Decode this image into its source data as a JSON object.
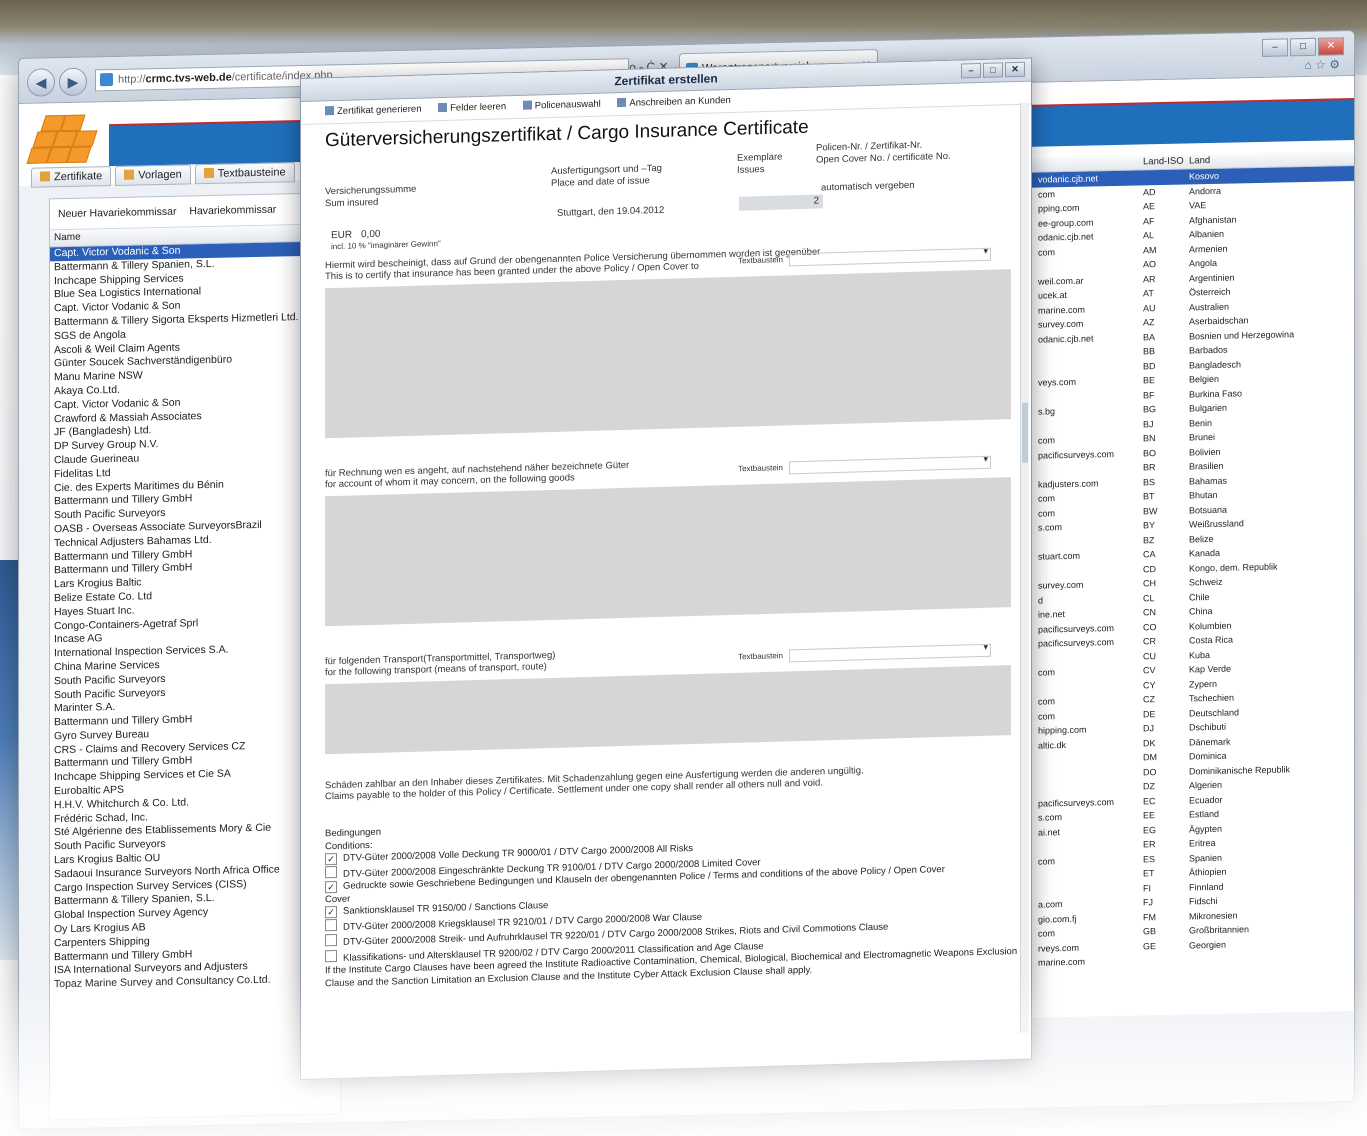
{
  "browser": {
    "url_prefix": "http://",
    "url_domain": "crmc.tvs-web.de",
    "url_path": "/certificate/index.php",
    "address_controls": "ρ - Ċ ✕",
    "tab_title": "Warentransportversicherung",
    "tab_close": "✕"
  },
  "app": {
    "tabs": [
      "Zertifikate",
      "Vorlagen",
      "Textbausteine"
    ],
    "left_toolbar": [
      "Neuer Havariekommissar",
      "Havariekommissar"
    ],
    "left_column_header": "Name",
    "surveyors": [
      "Capt. Victor Vodanic & Son",
      "Battermann & Tillery Spanien, S.L.",
      "Inchcape Shipping Services",
      "Blue Sea Logistics International",
      "Capt. Victor Vodanic & Son",
      "Battermann & Tillery Sigorta Eksperts Hizmetleri Ltd. Sti.",
      "SGS de Angola",
      "Ascoli & Weil Claim Agents",
      "Günter Soucek Sachverständigenbüro",
      "Manu Marine NSW",
      "Akaya Co.Ltd.",
      "Capt. Victor Vodanic & Son",
      "Crawford & Massiah Associates",
      "JF (Bangladesh) Ltd.",
      "DP Survey Group N.V.",
      "Claude Guerineau",
      "Fidelitas Ltd",
      "Cie. des Experts Maritimes du Bénin",
      "Battermann und Tillery GmbH",
      "South Pacific Surveyors",
      "OASB - Overseas Associate SurveyorsBrazil",
      "Technical Adjusters Bahamas Ltd.",
      "Battermann und Tillery GmbH",
      "Battermann und Tillery GmbH",
      "Lars Krogius Baltic",
      "Belize Estate Co. Ltd",
      "Hayes Stuart Inc.",
      "Congo-Containers-Agetraf Sprl",
      "Incase AG",
      "International Inspection Services S.A.",
      "China Marine Services",
      "South Pacific Surveyors",
      "South Pacific Surveyors",
      "Marinter S.A.",
      "Battermann und Tillery GmbH",
      "Gyro Survey Bureau",
      "CRS - Claims and Recovery Services CZ",
      "Battermann und Tillery GmbH",
      "Inchcape Shipping Services et Cie SA",
      "Eurobaltic APS",
      "H.H.V. Whitchurch & Co. Ltd.",
      "Frédéric Schad, Inc.",
      "Sté Algérienne des Etablissements Mory & Cie",
      "South Pacific Surveyors",
      "Lars Krogius Baltic OU",
      "Sadaoui Insurance Surveyors North Africa Office",
      "Cargo Inspection Survey Services (CISS)",
      "Battermann & Tillery Spanien, S.L.",
      "Global Inspection Survey Agency",
      "Oy Lars Krogius AB",
      "Carpenters Shipping",
      "Battermann und Tillery GmbH",
      "ISA International Surveyors and Adjusters",
      "Topaz Marine Survey and Consultancy Co.Ltd."
    ],
    "right_headers": [
      "Land-ISO",
      "Land"
    ],
    "countries": [
      {
        "email": "vodanic.cjb.net",
        "iso": "",
        "land": "Kosovo"
      },
      {
        "email": "com",
        "iso": "AD",
        "land": "Andorra"
      },
      {
        "email": "pping.com",
        "iso": "AE",
        "land": "VAE"
      },
      {
        "email": "ee-group.com",
        "iso": "AF",
        "land": "Afghanistan"
      },
      {
        "email": "odanic.cjb.net",
        "iso": "AL",
        "land": "Albanien"
      },
      {
        "email": "com",
        "iso": "AM",
        "land": "Armenien"
      },
      {
        "email": "",
        "iso": "AO",
        "land": "Angola"
      },
      {
        "email": "weil.com.ar",
        "iso": "AR",
        "land": "Argentinien"
      },
      {
        "email": "ucek.at",
        "iso": "AT",
        "land": "Österreich"
      },
      {
        "email": "marine.com",
        "iso": "AU",
        "land": "Australien"
      },
      {
        "email": "survey.com",
        "iso": "AZ",
        "land": "Aserbaidschan"
      },
      {
        "email": "odanic.cjb.net",
        "iso": "BA",
        "land": "Bosnien und Herzegowina"
      },
      {
        "email": "",
        "iso": "BB",
        "land": "Barbados"
      },
      {
        "email": "",
        "iso": "BD",
        "land": "Bangladesch"
      },
      {
        "email": "veys.com",
        "iso": "BE",
        "land": "Belgien"
      },
      {
        "email": "",
        "iso": "BF",
        "land": "Burkina Faso"
      },
      {
        "email": "s.bg",
        "iso": "BG",
        "land": "Bulgarien"
      },
      {
        "email": "",
        "iso": "BJ",
        "land": "Benin"
      },
      {
        "email": "com",
        "iso": "BN",
        "land": "Brunei"
      },
      {
        "email": "pacificsurveys.com",
        "iso": "BO",
        "land": "Bolivien"
      },
      {
        "email": "",
        "iso": "BR",
        "land": "Brasilien"
      },
      {
        "email": "kadjusters.com",
        "iso": "BS",
        "land": "Bahamas"
      },
      {
        "email": "com",
        "iso": "BT",
        "land": "Bhutan"
      },
      {
        "email": "com",
        "iso": "BW",
        "land": "Botsuana"
      },
      {
        "email": "s.com",
        "iso": "BY",
        "land": "Weißrussland"
      },
      {
        "email": "",
        "iso": "BZ",
        "land": "Belize"
      },
      {
        "email": "stuart.com",
        "iso": "CA",
        "land": "Kanada"
      },
      {
        "email": "",
        "iso": "CD",
        "land": "Kongo, dem. Republik"
      },
      {
        "email": "survey.com",
        "iso": "CH",
        "land": "Schweiz"
      },
      {
        "email": "d",
        "iso": "CL",
        "land": "Chile"
      },
      {
        "email": "ine.net",
        "iso": "CN",
        "land": "China"
      },
      {
        "email": "pacificsurveys.com",
        "iso": "CO",
        "land": "Kolumbien"
      },
      {
        "email": "pacificsurveys.com",
        "iso": "CR",
        "land": "Costa Rica"
      },
      {
        "email": "",
        "iso": "CU",
        "land": "Kuba"
      },
      {
        "email": "com",
        "iso": "CV",
        "land": "Kap Verde"
      },
      {
        "email": "",
        "iso": "CY",
        "land": "Zypern"
      },
      {
        "email": "com",
        "iso": "CZ",
        "land": "Tschechien"
      },
      {
        "email": "com",
        "iso": "DE",
        "land": "Deutschland"
      },
      {
        "email": "hipping.com",
        "iso": "DJ",
        "land": "Dschibuti"
      },
      {
        "email": "altic.dk",
        "iso": "DK",
        "land": "Dänemark"
      },
      {
        "email": "",
        "iso": "DM",
        "land": "Dominica"
      },
      {
        "email": "",
        "iso": "DO",
        "land": "Dominikanische Republik"
      },
      {
        "email": "",
        "iso": "DZ",
        "land": "Algerien"
      },
      {
        "email": "pacificsurveys.com",
        "iso": "EC",
        "land": "Ecuador"
      },
      {
        "email": "s.com",
        "iso": "EE",
        "land": "Estland"
      },
      {
        "email": "ai.net",
        "iso": "EG",
        "land": "Ägypten"
      },
      {
        "email": "",
        "iso": "ER",
        "land": "Eritrea"
      },
      {
        "email": "com",
        "iso": "ES",
        "land": "Spanien"
      },
      {
        "email": "",
        "iso": "ET",
        "land": "Äthiopien"
      },
      {
        "email": "",
        "iso": "FI",
        "land": "Finnland"
      },
      {
        "email": "a.com",
        "iso": "FJ",
        "land": "Fidschi"
      },
      {
        "email": "gio.com.fj",
        "iso": "FM",
        "land": "Mikronesien"
      },
      {
        "email": "com",
        "iso": "GB",
        "land": "Großbritannien"
      },
      {
        "email": "rveys.com",
        "iso": "GE",
        "land": "Georgien"
      },
      {
        "email": "marine.com",
        "iso": "",
        "land": ""
      }
    ]
  },
  "dialog": {
    "title": "Zertifikat erstellen",
    "toolbar": [
      "Zertifikat generieren",
      "Felder leeren",
      "Policenauswahl",
      "Anschreiben an Kunden"
    ],
    "heading": "Güterversicherungszertifikat / Cargo Insurance Certificate",
    "sum_label_de": "Versicherungssumme",
    "sum_label_en": "Sum insured",
    "place_label_de": "Ausfertigungsort und –Tag",
    "place_label_en": "Place and date of issue",
    "place_value": "Stuttgart, den 19.04.2012",
    "copies_label_de": "Exemplare",
    "copies_label_en": "Issues",
    "copies_value": "2",
    "policy_label_de": "Policen-Nr. / Zertifikat-Nr.",
    "policy_label_en": "Open Cover No. / certificate No.",
    "policy_value": "automatisch vergeben",
    "currency": "EUR",
    "amount": "0,00",
    "incl_note": "incl. 10 % \"imaginärer Gewinn\"",
    "textbaustein": "Textbaustein",
    "sec1_de": "Hiermit wird bescheinigt, dass auf Grund der obengenannten Police Versicherung übernommen worden ist gegenüber",
    "sec1_en": "This is to certify that insurance has been granted under the above Policy / Open Cover to",
    "sec2_de": "für Rechnung wen es angeht, auf nachstehend näher bezeichnete Güter",
    "sec2_en": "for account of whom it may concern, on the following goods",
    "sec3_de": "für folgenden Transport(Transportmittel, Transportweg)",
    "sec3_en": "for the following transport (means of transport, route)",
    "claims_de": "Schäden zahlbar an den Inhaber dieses Zertifikates. Mit Schadenzahlung gegen eine Ausfertigung werden die anderen ungültig.",
    "claims_en": "Claims payable to the holder of this Policy / Certificate. Settlement under one copy shall render all others null and void.",
    "conditions_de": "Bedingungen",
    "conditions_en": "Conditions:",
    "conditions": [
      {
        "checked": true,
        "text": "DTV-Güter 2000/2008 Volle Deckung TR 9000/01 / DTV Cargo 2000/2008 All Risks"
      },
      {
        "checked": false,
        "text": "DTV-Güter 2000/2008 Eingeschränkte Deckung TR 9100/01 / DTV Cargo 2000/2008 Limited Cover"
      },
      {
        "checked": true,
        "text": "Gedruckte sowie Geschriebene Bedingungen und Klauseln der obengenannten Police / Terms and conditions of the above Policy / Open Cover"
      },
      {
        "checked": true,
        "text": "Sanktionsklausel TR 9150/00 / Sanctions Clause"
      },
      {
        "checked": false,
        "text": "DTV-Güter 2000/2008 Kriegsklausel TR 9210/01 / DTV Cargo 2000/2008 War Clause"
      },
      {
        "checked": false,
        "text": "DTV-Güter 2000/2008 Streik- und Aufruhrklausel TR 9220/01 / DTV Cargo 2000/2008 Strikes, Riots and Civil Commotions Clause"
      },
      {
        "checked": false,
        "text": "Klassifikations- und Altersklausel TR 9200/02 / DTV Cargo 2000/2011 Classification and Age Clause"
      }
    ],
    "cover_label": "Cover",
    "footer_text": "If the Institute Cargo Clauses have been agreed the Institute Radioactive Contamination, Chemical, Biological, Biochemical and Electromagnetic Weapons Exclusion Clause and the Sanction Limitation an Exclusion Clause and the Institute Cyber Attack Exclusion Clause shall apply."
  }
}
